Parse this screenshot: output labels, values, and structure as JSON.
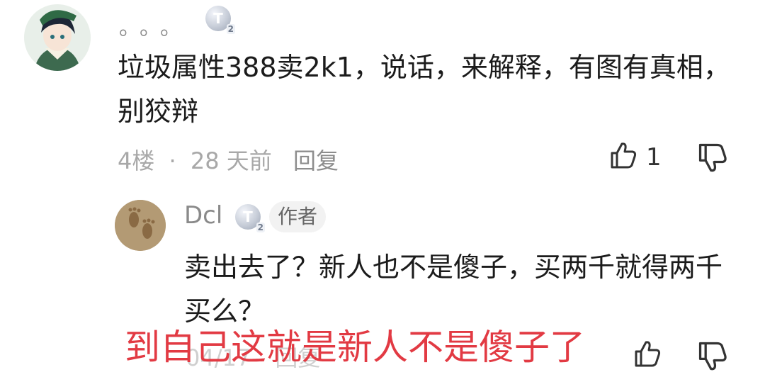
{
  "comment": {
    "username": "。。。",
    "badge_text": "T",
    "badge_sub": "2",
    "text": "垃圾属性388卖2k1，说话，来解释，有图有真相，别狡辩",
    "floor": "4楼",
    "dot": "·",
    "time": "28 天前",
    "reply_label": "回复",
    "like_count": "1"
  },
  "reply": {
    "username": "Dcl",
    "badge_text": "T",
    "badge_sub": "2",
    "author_tag": "作者",
    "text": "卖出去了？新人也不是傻子，买两千就得两千买么？",
    "time": "04/17",
    "reply_label": "回复"
  },
  "overlay_caption": "到自己这就是新人不是傻子了",
  "colors": {
    "overlay_red": "#e23a43",
    "meta_gray": "#a8a8a8",
    "text_dark": "#1b1b1b"
  }
}
